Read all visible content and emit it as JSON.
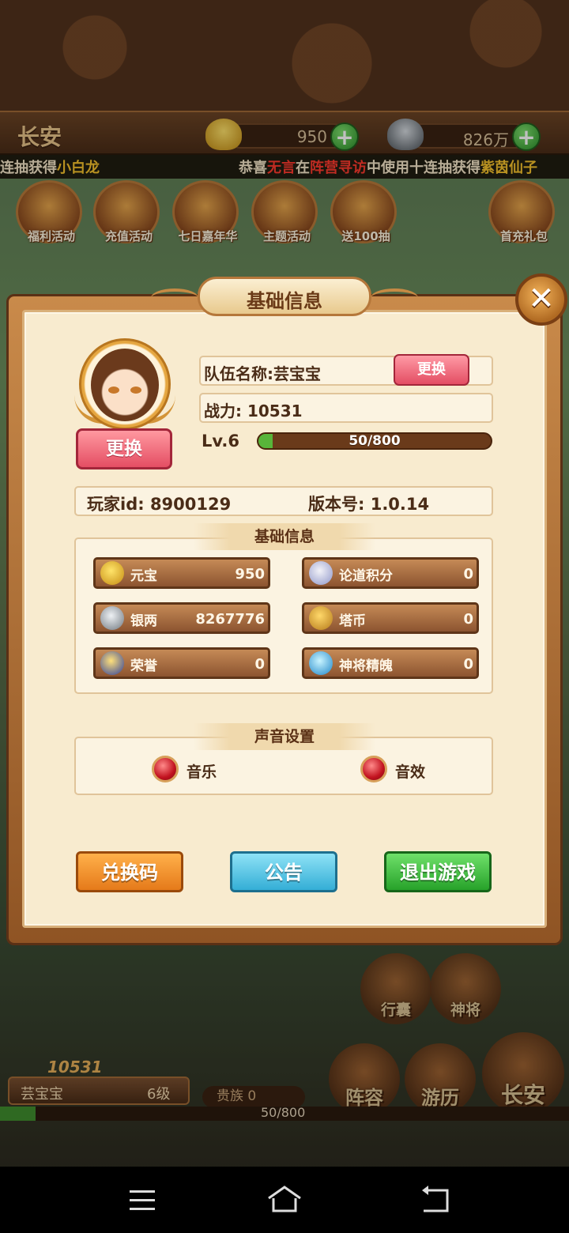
{
  "hud": {
    "city": "长安",
    "gold": "950",
    "silver": "826万",
    "plus": "+"
  },
  "ticker": {
    "left_part1": "连抽获得",
    "left_name": "小白龙",
    "right_prefix": "恭喜",
    "right_player": "无言",
    "right_mid": "在",
    "right_event": "阵营寻访",
    "right_mid2": "中使用十连抽获得",
    "right_reward": "紫茵仙子"
  },
  "activities": [
    {
      "label": "福利活动"
    },
    {
      "label": "充值活动"
    },
    {
      "label": "七日嘉年华"
    },
    {
      "label": "主题活动"
    },
    {
      "label": "送100抽"
    },
    {
      "label": "首充礼包"
    }
  ],
  "dialog": {
    "title": "基础信息",
    "close": "✕",
    "change_avatar": "更换",
    "team_name": "队伍名称:芸宝宝",
    "rename": "更换",
    "power": "战力:  10531",
    "level": "Lv.6",
    "xp_text": "50/800",
    "xp_fraction": 0.0625,
    "player_id": "玩家id: 8900129",
    "version": "版本号:  1.0.14",
    "basic_section": "基础信息",
    "resources": [
      {
        "label": "元宝",
        "value": "950",
        "icon": "gold-ingot-icon"
      },
      {
        "label": "论道积分",
        "value": "0",
        "icon": "scroll-icon"
      },
      {
        "label": "银两",
        "value": "8267776",
        "icon": "silver-ingot-icon"
      },
      {
        "label": "塔币",
        "value": "0",
        "icon": "coins-icon"
      },
      {
        "label": "荣誉",
        "value": "0",
        "icon": "honor-badge-icon"
      },
      {
        "label": "神将精魄",
        "value": "0",
        "icon": "spirit-crystal-icon"
      }
    ],
    "sound_section": "声音设置",
    "music": "音乐",
    "sfx": "音效",
    "redeem": "兑换码",
    "notice": "公告",
    "exit": "退出游戏"
  },
  "bottom": {
    "power": "10531",
    "team": "芸宝宝",
    "level": "6级",
    "noble": "贵族 0",
    "xp_text": "50/800",
    "xp_fraction": 0.0625,
    "bag": "行囊",
    "general": "神将",
    "formation": "阵容",
    "travel": "游历",
    "city": "长安"
  },
  "colors": {
    "dialog_bg": "#f8ebcf",
    "pink_button": "#e44e63",
    "orange_button": "#f0902a",
    "blue_button": "#4cc3e6",
    "green_button": "#36b33a"
  }
}
